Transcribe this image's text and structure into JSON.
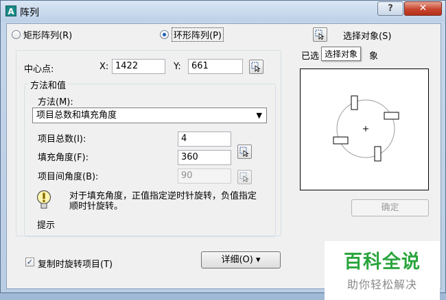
{
  "window": {
    "title": "阵列",
    "help_label": "?",
    "close_label": "✕"
  },
  "array_type": {
    "rectangular_label": "矩形阵列(R)",
    "polar_label": "环形阵列(P)",
    "selected": "polar"
  },
  "select_objects": {
    "label": "选择对象(S)",
    "status_prefix": "已选",
    "status_suffix": "象",
    "tooltip": "选择对象"
  },
  "center_point": {
    "label": "中心点:",
    "x_label": "X:",
    "x_value": "1422",
    "y_label": "Y:",
    "y_value": "661"
  },
  "method_group": {
    "title": "方法和值",
    "method_label": "方法(M):",
    "method_value": "项目总数和填充角度",
    "total_items_label": "项目总数(I):",
    "total_items_value": "4",
    "fill_angle_label": "填充角度(F):",
    "fill_angle_value": "360",
    "item_angle_label": "项目间角度(B):",
    "item_angle_value": "90"
  },
  "tip": {
    "text": "对于填充角度，正值指定逆时针旋转，负值指定顺时针旋转。",
    "label": "提示"
  },
  "rotate_items": {
    "label": "复制时旋转项目(T)",
    "checked": true
  },
  "details_button": {
    "label": "详细(O) ▾"
  },
  "ok_button": {
    "label": "确定"
  },
  "watermark": {
    "main": "百科全说",
    "sub": "助你轻松解决"
  },
  "colors": {
    "accent_blue": "#1c5fb8",
    "close_red": "#c8452e",
    "watermark_green": "#2aa53d"
  }
}
